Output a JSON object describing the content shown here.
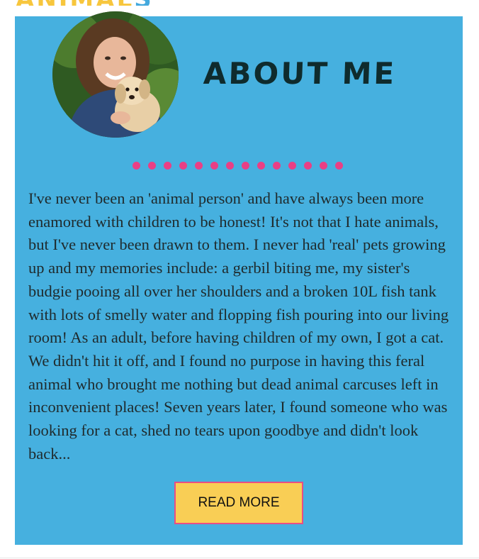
{
  "banner": {
    "text_main": "ANIMAL",
    "text_accent": "S"
  },
  "about": {
    "title": "About Me",
    "avatar_icon": "profile-photo-woman-with-puppy",
    "paragraph": "I've never been an 'animal person' and have always been more enamored with children to be honest! It's not that I hate animals, but I've never been drawn to them. I never had 'real' pets growing up and my memories include: a gerbil biting me, my sister's budgie pooing all over her shoulders and a broken 10L fish tank with lots of smelly water and flopping fish pouring into our living room! As an adult, before having children of my own, I got a cat. We didn't hit it off, and I found no purpose in having this feral animal who brought me nothing but dead animal carcuses left in inconvenient places! Seven years later, I found someone who was looking for a cat, shed no tears upon goodbye and didn't look back...",
    "read_more_label": "READ MORE",
    "divider_dot_count": 14
  },
  "colors": {
    "card_bg": "#46b0df",
    "dot": "#ea3f85",
    "button_bg": "#f9ce55",
    "button_border": "#e94d84",
    "title": "#0f2b2d",
    "banner_yellow": "#f7c63d",
    "banner_blue": "#44a9dd"
  }
}
